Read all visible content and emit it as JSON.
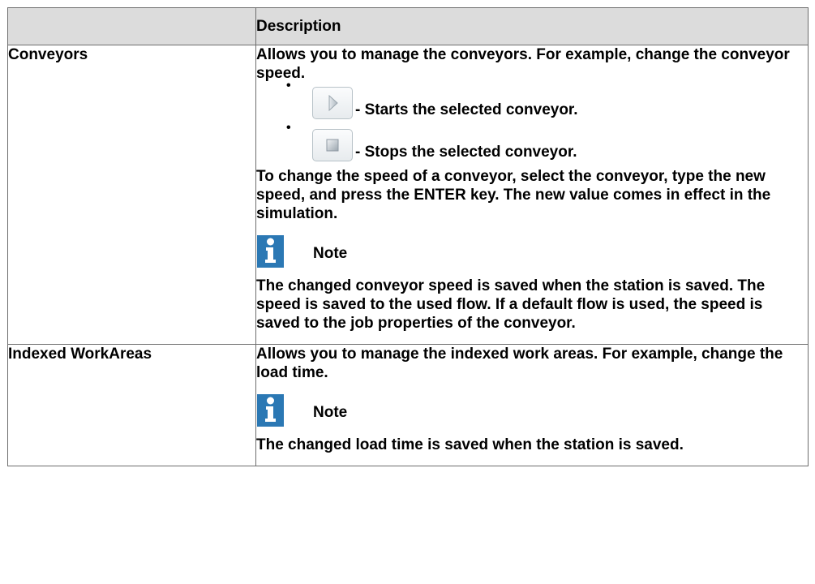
{
  "table": {
    "header": {
      "col1": "",
      "col2": "Description"
    },
    "rows": [
      {
        "name": "Conveyors",
        "intro": "Allows you to manage the conveyors. For example, change the conveyor speed.",
        "bullets": [
          {
            "icon": "play-icon",
            "text": "- Starts the selected conveyor."
          },
          {
            "icon": "stop-icon",
            "text": "- Stops the selected conveyor."
          }
        ],
        "para": "To change the speed of a conveyor, select the conveyor, type the new speed, and press the ENTER key. The new value comes in effect in the simulation.",
        "note_label": "Note",
        "note_icon": "info-icon",
        "note_text": "The changed conveyor speed is saved when the station is saved. The speed is saved to the used flow. If a default flow is used, the speed is saved to the job properties of the conveyor."
      },
      {
        "name": "Indexed WorkAreas",
        "intro": "Allows you to manage the indexed work areas. For example, change the load time.",
        "note_label": "Note",
        "note_icon": "info-icon",
        "note_text": "The changed load time is saved when the station is saved."
      }
    ]
  },
  "colors": {
    "header_bg": "#dcdcdc",
    "note_icon": "#2b78b4",
    "border": "#6d6d6d"
  }
}
